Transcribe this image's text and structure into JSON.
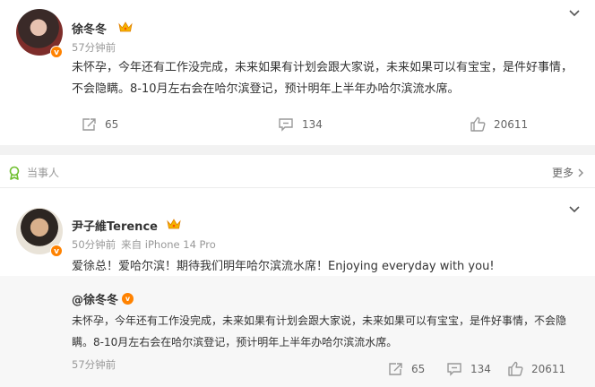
{
  "post": {
    "author": "徐冬冬",
    "time": "57分钟前",
    "text": "未怀孕，今年还有工作没完成，未来如果有计划会跟大家说，未来如果可以有宝宝，是件好事情，不会隐瞒。8-10月左右会在哈尔滨登记，预计明年上半年办哈尔滨流水席。",
    "reposts": "65",
    "comments": "134",
    "likes": "20611"
  },
  "section": {
    "label": "当事人",
    "more_label": "更多"
  },
  "comment": {
    "author": "尹子維Terence",
    "time": "50分钟前",
    "source": "来自 iPhone 14 Pro",
    "text": "爱徐总！爱哈尔滨！期待我们明年哈尔滨流水席！Enjoying everyday with you!"
  },
  "quoted": {
    "author": "@徐冬冬",
    "text": "未怀孕，今年还有工作没完成，未来如果有计划会跟大家说，未来如果可以有宝宝，是件好事情，不会隐瞒。8-10月左右会在哈尔滨登记，预计明年上半年办哈尔滨流水席。",
    "time": "57分钟前",
    "reposts": "65",
    "comments": "134",
    "likes": "20611"
  },
  "icons": {
    "badge_color": "#ff8200",
    "crown": "crown-icon",
    "verified": "verified-v-icon",
    "repost": "repost-icon",
    "comment": "comment-icon",
    "like": "thumb-up-icon",
    "chevron": "chevron-down-icon",
    "stakeholder": "stakeholder-icon"
  }
}
